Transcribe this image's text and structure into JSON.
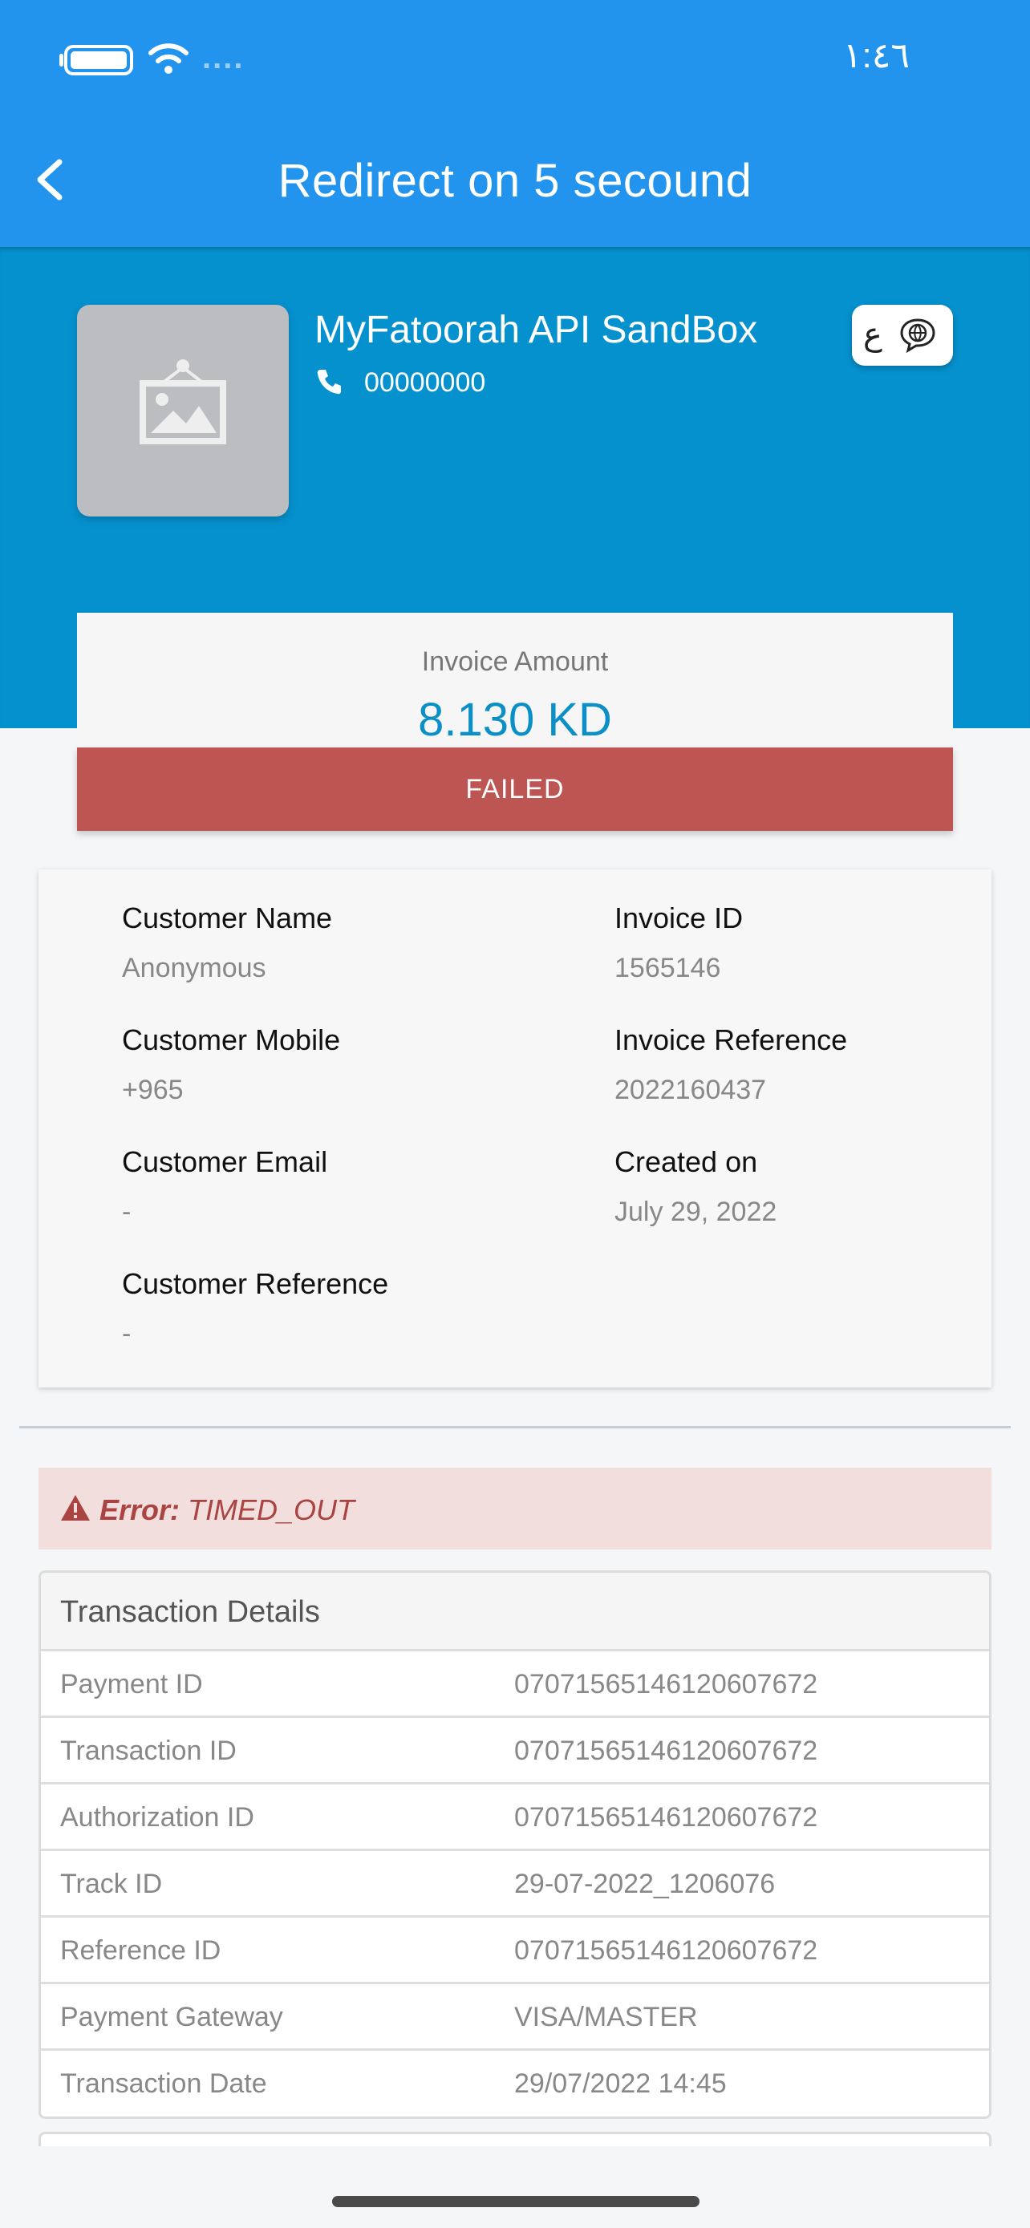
{
  "status_bar": {
    "time": "١:٤٦",
    "carrier_dots": "....",
    "icons": [
      "battery-icon",
      "wifi-icon"
    ]
  },
  "nav": {
    "title": "Redirect on 5 secound",
    "back_icon": "chevron-left-icon"
  },
  "merchant": {
    "name": "MyFatoorah API SandBox",
    "phone": "00000000",
    "logo_icon": "image-placeholder-icon",
    "language_button": {
      "letter": "ع",
      "icon": "language-globe-icon"
    }
  },
  "invoice": {
    "amount_label": "Invoice Amount",
    "amount": "8.130 KD",
    "status": "FAILED"
  },
  "customer_info": {
    "left": [
      {
        "label": "Customer Name",
        "value": "Anonymous"
      },
      {
        "label": "Customer Mobile",
        "value": "+965"
      },
      {
        "label": "Customer Email",
        "value": "-"
      },
      {
        "label": "Customer Reference",
        "value": "-"
      }
    ],
    "right": [
      {
        "label": "Invoice ID",
        "value": "1565146"
      },
      {
        "label": "Invoice Reference",
        "value": "2022160437"
      },
      {
        "label": "Created on",
        "value": "July 29, 2022"
      }
    ]
  },
  "error": {
    "prefix": "Error:",
    "message": "TIMED_OUT",
    "icon": "warning-icon"
  },
  "transaction": {
    "title": "Transaction Details",
    "rows": [
      {
        "key": "Payment ID",
        "value": "07071565146120607672"
      },
      {
        "key": "Transaction ID",
        "value": "07071565146120607672"
      },
      {
        "key": "Authorization ID",
        "value": "07071565146120607672"
      },
      {
        "key": "Track ID",
        "value": "29-07-2022_1206076"
      },
      {
        "key": "Reference ID",
        "value": "07071565146120607672"
      },
      {
        "key": "Payment Gateway",
        "value": "VISA/MASTER"
      },
      {
        "key": "Transaction Date",
        "value": "29/07/2022 14:45"
      }
    ]
  },
  "colors": {
    "nav_blue": "#2394ee",
    "merchant_blue": "#0591ce",
    "amount_blue": "#0b8fc7",
    "failed_red": "#bd5652",
    "error_bg": "#f3dede",
    "error_text": "#a94442"
  }
}
